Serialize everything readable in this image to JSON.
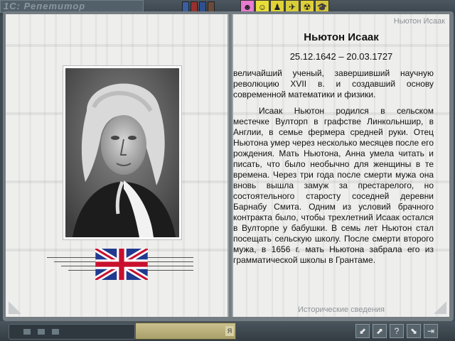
{
  "app": {
    "logo_text": "1С: Репетитор"
  },
  "top_toolbar": {
    "book_icons": [
      {
        "name": "blue-book-icon",
        "color": "#3a5fa0"
      },
      {
        "name": "red-book-icon",
        "color": "#9a3030"
      },
      {
        "name": "blue-book-icon-2",
        "color": "#2f4f8f"
      },
      {
        "name": "dark-book-icon",
        "color": "#6a4a3a"
      }
    ],
    "mode_tabs": [
      {
        "name": "tab-pink",
        "glyph": "☻",
        "color": "#e87ad0"
      },
      {
        "name": "tab-yellow-1",
        "glyph": "☺",
        "color": "#e8df3a"
      },
      {
        "name": "tab-yellow-2",
        "glyph": "♟",
        "color": "#e0d236"
      },
      {
        "name": "tab-yellow-3",
        "glyph": "✈",
        "color": "#d8cc3a"
      },
      {
        "name": "tab-yellow-4",
        "glyph": "☢",
        "color": "#e0d03a"
      },
      {
        "name": "tab-yellow-5",
        "glyph": "🎓",
        "color": "#d4c63a"
      }
    ]
  },
  "left_page": {
    "portrait_label": "Isaac Newton portrait",
    "flag_label": "United Kingdom flag"
  },
  "right_page": {
    "header": "Ньютон Исаак",
    "name": "Ньютон Исаак",
    "dates": "25.12.1642 – 20.03.1727",
    "paragraphs": [
      "величайший ученый, завершивший научную революцию XVII в. и создавший основу современной математики и физики.",
      "Исаак Ньютон родился в сельском местечке Вулторп в графстве Линкольншир, в Англии, в семье фермера средней руки. Отец Ньютона умер через несколько месяцев после его рождения. Мать Ньютона, Анна умела читать и писать, что было необычно для женщины в те времена. Через три года после смерти мужа она вновь вышла замуж за престарелого, но состоятельного старосту соседней деревни Барнабу Смита. Одним из условий брачного контракта было, чтобы трехлетний Исаак остался в Вулторпе у бабушки. В семь лет Ньютон стал посещать сельскую школу. После смерти второго мужа, в 1656 г. мать Ньютона забрала его из грамматической школы в Грантаме."
    ],
    "footer": "Исторические сведения"
  },
  "bottom_bar": {
    "panel_letter": "Я",
    "buttons": [
      {
        "name": "back-arrow-button",
        "glyph": "⬋"
      },
      {
        "name": "forward-arrow-button",
        "glyph": "⬈"
      },
      {
        "name": "help-button",
        "glyph": "?"
      },
      {
        "name": "down-arrow-button",
        "glyph": "⬊"
      },
      {
        "name": "exit-button",
        "glyph": "⇥"
      }
    ]
  }
}
